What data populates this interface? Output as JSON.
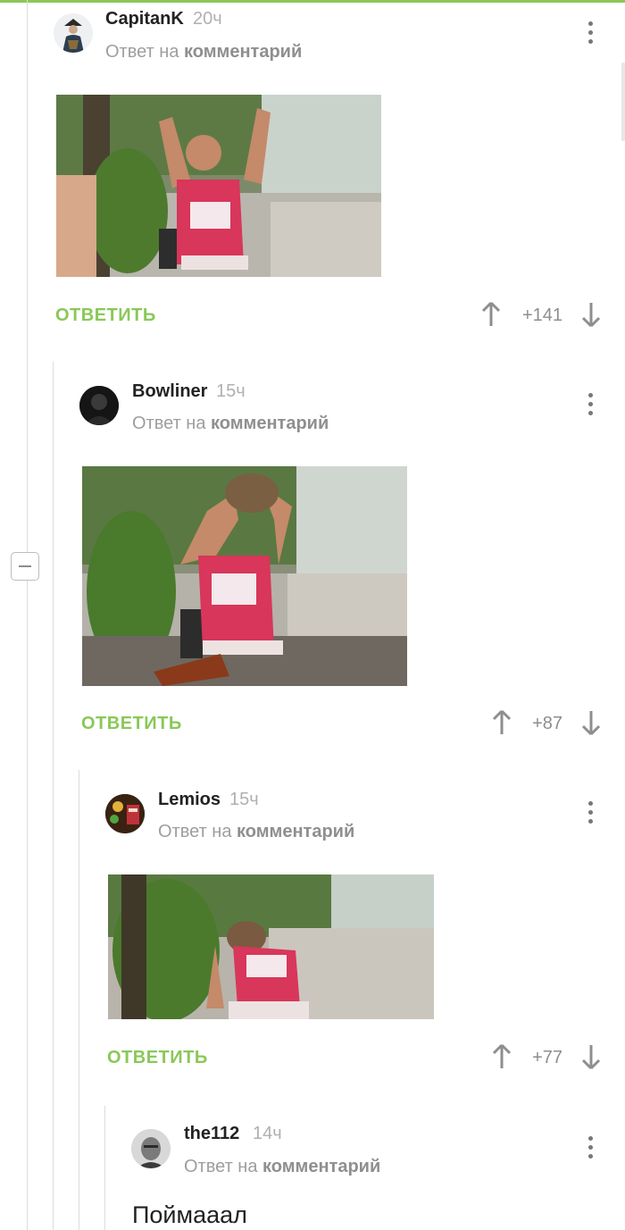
{
  "colors": {
    "accent": "#8ac858",
    "muted": "#9e9e9e",
    "text": "#222222"
  },
  "comments": [
    {
      "username": "CapitanK",
      "time": "20ч",
      "reply_prefix": "Ответ на",
      "reply_target": "комментарий",
      "image_alt": "man in red tank top raising hands outdoors",
      "reply_label": "ОТВЕТИТЬ",
      "score": "+141",
      "avatar_icon": "pirate-avatar"
    },
    {
      "username": "Bowliner",
      "time": "15ч",
      "reply_prefix": "Ответ на",
      "reply_target": "комментарий",
      "image_alt": "man in red tank top drinking from bottle outdoors",
      "reply_label": "ОТВЕТИТЬ",
      "score": "+87",
      "avatar_icon": "dark-portrait-avatar"
    },
    {
      "username": "Lemios",
      "time": "15ч",
      "reply_prefix": "Ответ на",
      "reply_target": "комментарий",
      "image_alt": "man in red tank top falling backward",
      "reply_label": "ОТВЕТИТЬ",
      "score": "+77",
      "avatar_icon": "colorful-avatar"
    },
    {
      "username": "the112",
      "time": "14ч",
      "reply_prefix": "Ответ на",
      "reply_target": "комментарий",
      "text": "Поймааал",
      "avatar_icon": "bw-face-avatar"
    }
  ]
}
